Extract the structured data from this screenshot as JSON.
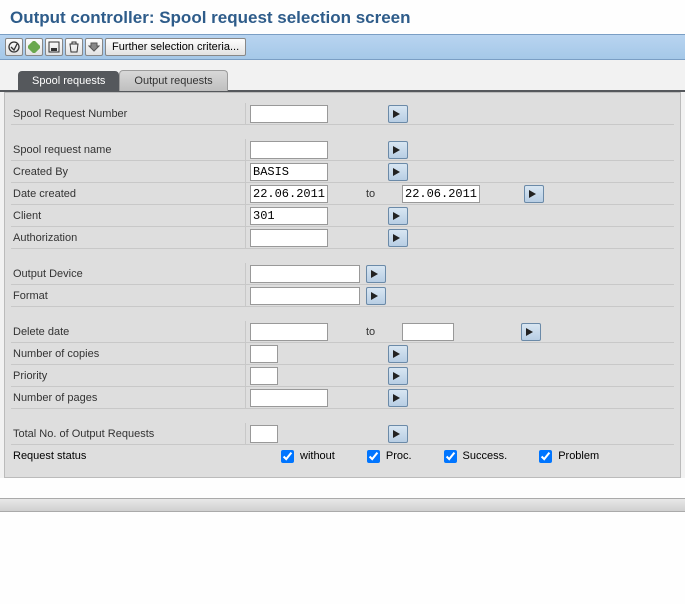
{
  "header": {
    "title": "Output controller: Spool request selection screen"
  },
  "toolbar": {
    "icons": [
      "execute",
      "execute-variant",
      "save",
      "delete",
      "dynamic-selections"
    ],
    "further_label": "Further selection criteria..."
  },
  "tabs": {
    "active": "Spool requests",
    "inactive": "Output requests"
  },
  "labels": {
    "spool_request_number": "Spool Request Number",
    "spool_request_name": "Spool request name",
    "created_by": "Created By",
    "date_created": "Date created",
    "client": "Client",
    "authorization": "Authorization",
    "output_device": "Output Device",
    "format": "Format",
    "delete_date": "Delete date",
    "number_of_copies": "Number of copies",
    "priority": "Priority",
    "number_of_pages": "Number of pages",
    "total_output_requests": "Total No. of Output Requests",
    "request_status": "Request status",
    "to": "to"
  },
  "values": {
    "spool_request_number": "",
    "spool_request_name": "",
    "created_by": "BASIS",
    "date_created_from": "22.06.2011",
    "date_created_to": "22.06.2011",
    "client": "301",
    "authorization": "",
    "output_device": "",
    "format": "",
    "delete_date_from": "",
    "delete_date_to": "",
    "number_of_copies": "",
    "priority": "",
    "number_of_pages": "",
    "total_output_requests": ""
  },
  "status_checks": {
    "without": {
      "label": "without",
      "checked": true
    },
    "proc": {
      "label": "Proc.",
      "checked": true
    },
    "success": {
      "label": "Success.",
      "checked": true
    },
    "problem": {
      "label": "Problem",
      "checked": true
    }
  }
}
